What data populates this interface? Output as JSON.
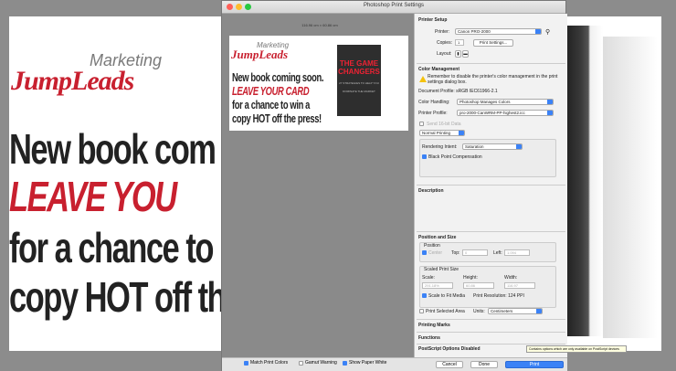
{
  "window": {
    "title": "Photoshop Print Settings"
  },
  "background": {
    "logo_top": "Marketing",
    "logo_bottom": "JumpLeads",
    "lines": [
      "New book com",
      "LEAVE YOU",
      "for a chance to",
      "copy HOT off th"
    ]
  },
  "preview": {
    "ruler": "116.96 cm × 60.86 cm",
    "logo_top": "Marketing",
    "logo_bottom": "JumpLeads",
    "lines": [
      "New book coming soon.",
      "LEAVE YOUR CARD",
      "for a chance to win a",
      "copy HOT off the press!"
    ],
    "book_title": "THE GAME CHANGERS",
    "book_sub": "27 STRATEGIES TO HELP YOU DOMINATE THE MARKET"
  },
  "printer_setup": {
    "heading": "Printer Setup",
    "printer_label": "Printer:",
    "printer_value": "Canon PRO-2000",
    "copies_label": "Copies:",
    "copies_value": "1",
    "print_settings_button": "Print Settings...",
    "layout_label": "Layout:"
  },
  "color_management": {
    "heading": "Color Management",
    "warning": "Remember to disable the printer's color management in the print settings dialog box.",
    "doc_profile": "Document Profile: sRGB IEC61966-2.1",
    "handling_label": "Color Handling:",
    "handling_value": "Photoshop Manages Colors",
    "profile_label": "Printer Profile:",
    "profile_value": "pro-2000-CanWRM-PP-highest2.icc",
    "send16": "Send 16-bit Data",
    "normal_printing": "Normal Printing",
    "intent_label": "Rendering Intent:",
    "intent_value": "Saturation",
    "bpc": "Black Point Compensation"
  },
  "description": {
    "heading": "Description"
  },
  "position": {
    "heading": "Position and Size",
    "position_label": "Position",
    "center": "Center",
    "top_label": "Top:",
    "top_value": "0",
    "left_label": "Left:",
    "left_value": "1.094",
    "scaled_label": "Scaled Print Size",
    "scale_label": "Scale:",
    "scale_value": "291.18%",
    "height_label": "Height:",
    "height_value": "60.86",
    "width_label": "Width:",
    "width_value": "116.97",
    "scale_to_fit": "Scale to Fit Media",
    "resolution": "Print Resolution: 124 PPI",
    "print_selected": "Print Selected Area",
    "units_label": "Units:",
    "units_value": "Centimeters"
  },
  "sections": {
    "marks": "Printing Marks",
    "functions": "Functions",
    "postscript": "PostScript Options Disabled"
  },
  "tooltip": "Contains options which are only available on PostScript devices",
  "bottom": {
    "match_colors": "Match Print Colors",
    "gamut": "Gamut Warning",
    "paper_white": "Show Paper White",
    "cancel": "Cancel",
    "done": "Done",
    "print": "Print"
  }
}
